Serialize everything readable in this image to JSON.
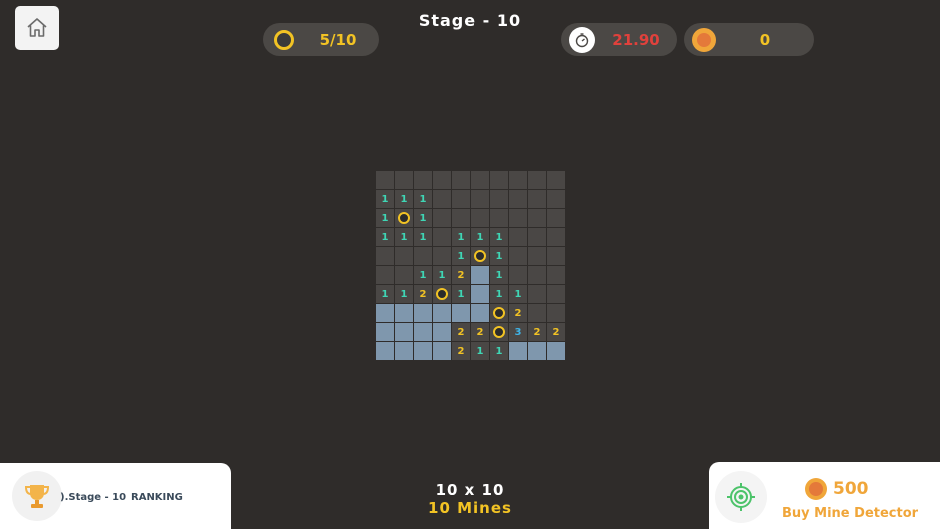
{
  "header": {
    "stage_title": "Stage - 10",
    "mines_found": "5/10",
    "timer": "21.90",
    "coins": "0"
  },
  "board": {
    "rows": [
      [
        [
          "h",
          ""
        ],
        [
          "h",
          ""
        ],
        [
          "h",
          ""
        ],
        [
          "h",
          ""
        ],
        [
          "h",
          ""
        ],
        [
          "h",
          ""
        ],
        [
          "h",
          ""
        ],
        [
          "h",
          ""
        ],
        [
          "h",
          ""
        ],
        [
          "h",
          ""
        ]
      ],
      [
        [
          "o",
          "1"
        ],
        [
          "o",
          "1"
        ],
        [
          "o",
          "1"
        ],
        [
          "h",
          ""
        ],
        [
          "h",
          ""
        ],
        [
          "h",
          ""
        ],
        [
          "h",
          ""
        ],
        [
          "h",
          ""
        ],
        [
          "h",
          ""
        ],
        [
          "h",
          ""
        ]
      ],
      [
        [
          "o",
          "1"
        ],
        [
          "m",
          ""
        ],
        [
          "o",
          "1"
        ],
        [
          "h",
          ""
        ],
        [
          "h",
          ""
        ],
        [
          "h",
          ""
        ],
        [
          "h",
          ""
        ],
        [
          "h",
          ""
        ],
        [
          "h",
          ""
        ],
        [
          "h",
          ""
        ]
      ],
      [
        [
          "o",
          "1"
        ],
        [
          "o",
          "1"
        ],
        [
          "o",
          "1"
        ],
        [
          "h",
          ""
        ],
        [
          "o",
          "1"
        ],
        [
          "o",
          "1"
        ],
        [
          "o",
          "1"
        ],
        [
          "h",
          ""
        ],
        [
          "h",
          ""
        ],
        [
          "h",
          ""
        ]
      ],
      [
        [
          "h",
          ""
        ],
        [
          "h",
          ""
        ],
        [
          "h",
          ""
        ],
        [
          "h",
          ""
        ],
        [
          "o",
          "1"
        ],
        [
          "m",
          ""
        ],
        [
          "o",
          "1"
        ],
        [
          "h",
          ""
        ],
        [
          "h",
          ""
        ],
        [
          "h",
          ""
        ]
      ],
      [
        [
          "h",
          ""
        ],
        [
          "h",
          ""
        ],
        [
          "o",
          "1"
        ],
        [
          "o",
          "1"
        ],
        [
          "o",
          "2"
        ],
        [
          "b",
          ""
        ],
        [
          "o",
          "1"
        ],
        [
          "h",
          ""
        ],
        [
          "h",
          ""
        ],
        [
          "h",
          ""
        ]
      ],
      [
        [
          "o",
          "1"
        ],
        [
          "o",
          "1"
        ],
        [
          "o",
          "2"
        ],
        [
          "m",
          ""
        ],
        [
          "o",
          "1"
        ],
        [
          "b",
          ""
        ],
        [
          "o",
          "1"
        ],
        [
          "o",
          "1"
        ],
        [
          "h",
          ""
        ],
        [
          "h",
          ""
        ]
      ],
      [
        [
          "b",
          ""
        ],
        [
          "b",
          ""
        ],
        [
          "b",
          ""
        ],
        [
          "b",
          ""
        ],
        [
          "b",
          ""
        ],
        [
          "b",
          ""
        ],
        [
          "m",
          ""
        ],
        [
          "o",
          "2"
        ],
        [
          "h",
          ""
        ],
        [
          "h",
          ""
        ]
      ],
      [
        [
          "b",
          ""
        ],
        [
          "b",
          ""
        ],
        [
          "b",
          ""
        ],
        [
          "b",
          ""
        ],
        [
          "o",
          "2"
        ],
        [
          "o",
          "2"
        ],
        [
          "m",
          ""
        ],
        [
          "o",
          "3"
        ],
        [
          "o",
          "2"
        ],
        [
          "o",
          "2"
        ]
      ],
      [
        [
          "b",
          ""
        ],
        [
          "b",
          ""
        ],
        [
          "b",
          ""
        ],
        [
          "b",
          ""
        ],
        [
          "o",
          "2"
        ],
        [
          "o",
          "1"
        ],
        [
          "o",
          "1"
        ],
        [
          "b",
          ""
        ],
        [
          "b",
          ""
        ],
        [
          "b",
          ""
        ]
      ]
    ]
  },
  "footer": {
    "board_size": "10 x 10",
    "mine_count": "10 Mines"
  },
  "ranking": {
    "stage_text": ").Stage - 10",
    "label": "RANKING"
  },
  "detector": {
    "price": "500",
    "label": "Buy Mine Detector"
  },
  "colors": {
    "background": "#2f2c2a",
    "accent_yellow": "#f2c324",
    "timer_red": "#e0413c",
    "number_one": "#3fd6b5",
    "number_three": "#3fb4e8",
    "revealed_blue": "#7f97ad",
    "coin_orange": "#f0a63a"
  }
}
